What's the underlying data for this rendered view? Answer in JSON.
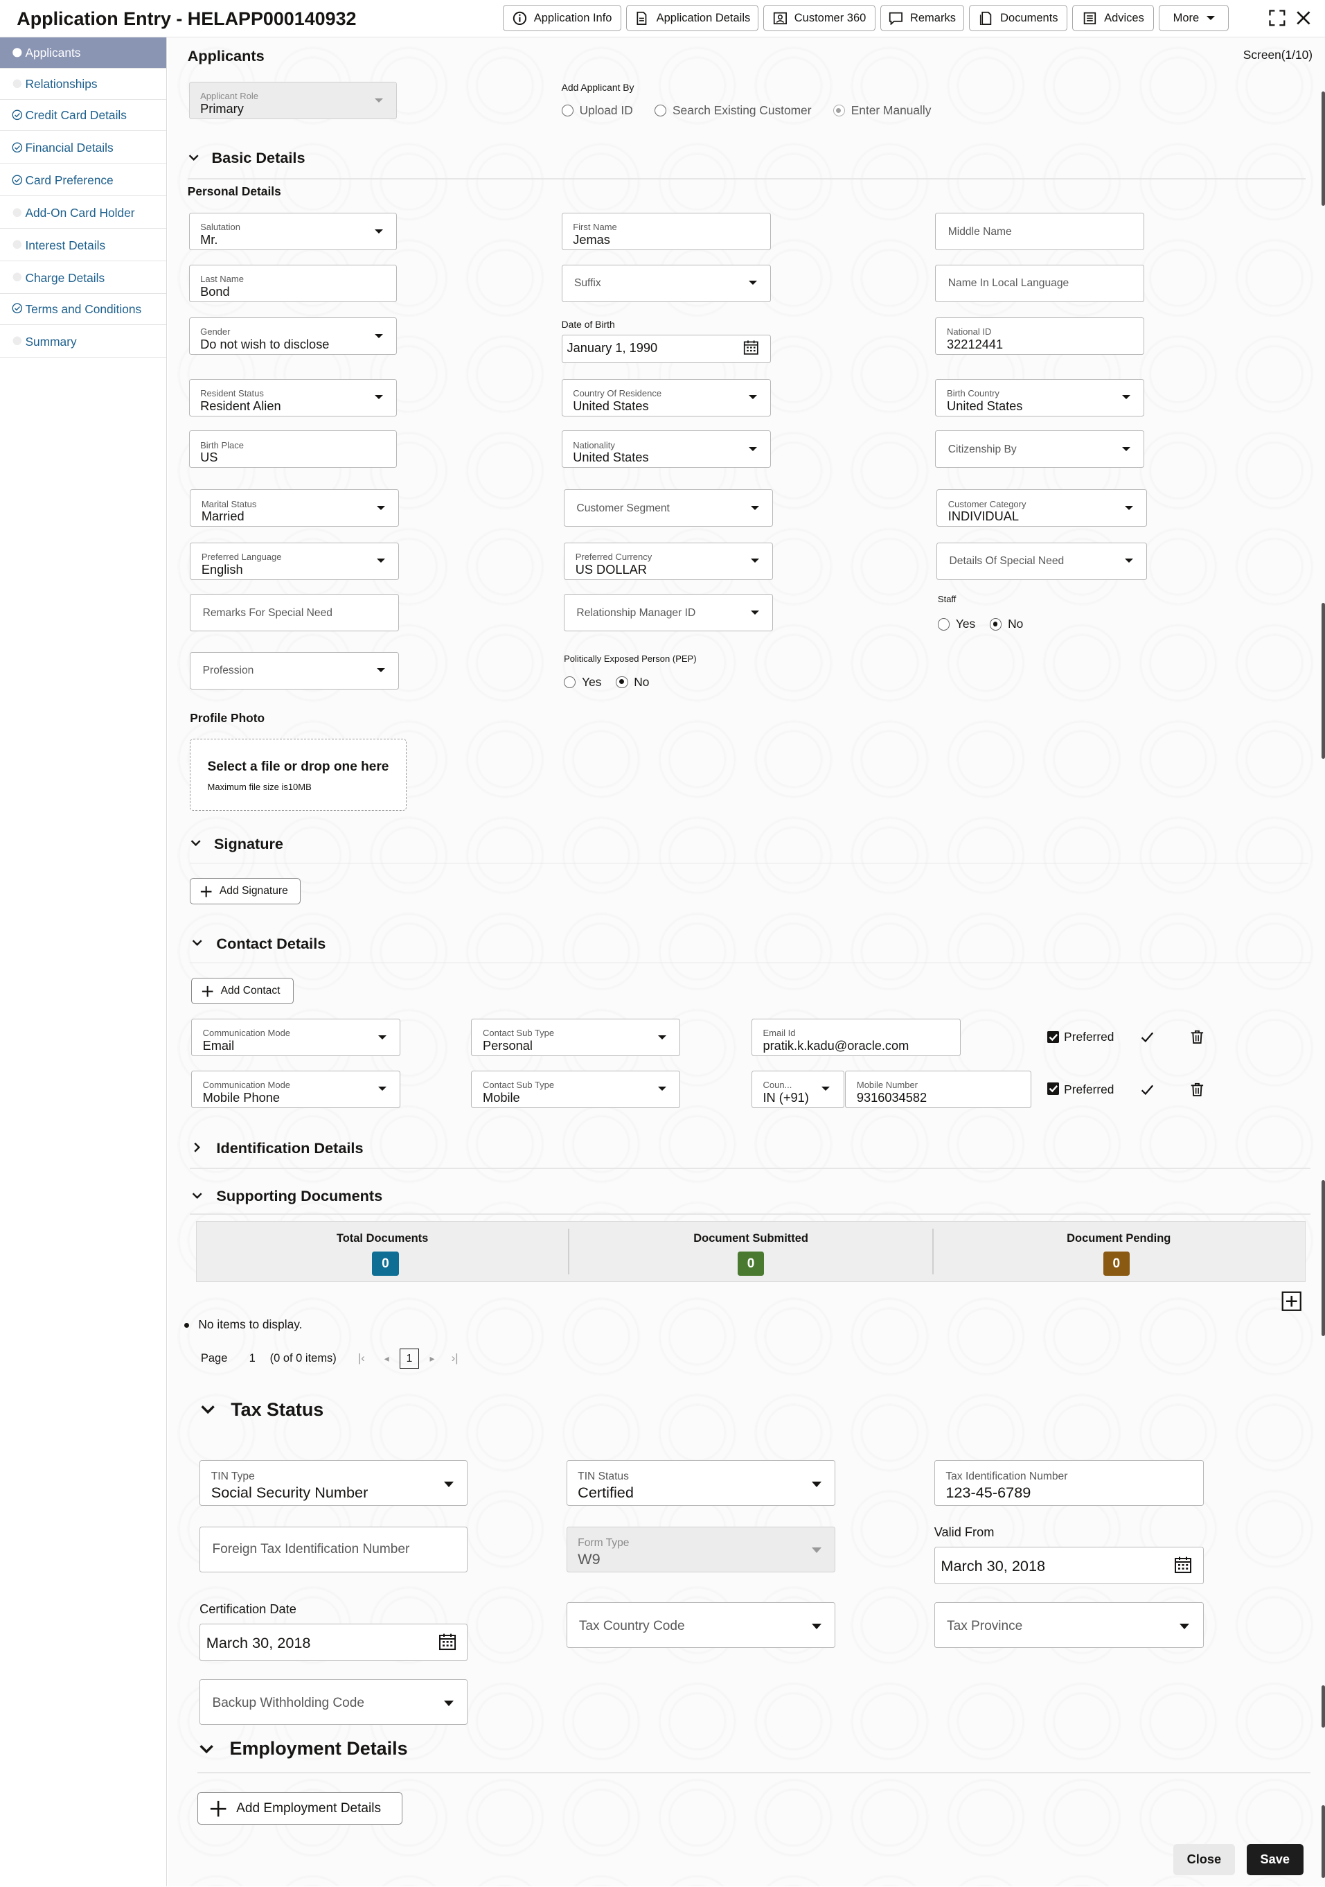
{
  "header": {
    "title": "Application Entry - HELAPP000140932",
    "buttons": [
      {
        "label": "Application Info",
        "icon": "info-icon"
      },
      {
        "label": "Application Details",
        "icon": "document-icon"
      },
      {
        "label": "Customer 360",
        "icon": "customer-card-icon"
      },
      {
        "label": "Remarks",
        "icon": "comment-icon"
      },
      {
        "label": "Documents",
        "icon": "documents-icon"
      },
      {
        "label": "Advices",
        "icon": "advices-icon"
      },
      {
        "label": "More",
        "icon": "chevron-down-icon"
      }
    ]
  },
  "sidebar": {
    "items": [
      {
        "label": "Applicants",
        "status": "current"
      },
      {
        "label": "Relationships",
        "status": "pending"
      },
      {
        "label": "Credit Card Details",
        "status": "done"
      },
      {
        "label": "Financial Details",
        "status": "done"
      },
      {
        "label": "Card Preference",
        "status": "done"
      },
      {
        "label": "Add-On Card Holder",
        "status": "pending"
      },
      {
        "label": "Interest Details",
        "status": "pending"
      },
      {
        "label": "Charge Details",
        "status": "pending"
      },
      {
        "label": "Terms and Conditions",
        "status": "done"
      },
      {
        "label": "Summary",
        "status": "pending"
      }
    ]
  },
  "page": {
    "title": "Applicants",
    "screen_indicator": "Screen(1/10)"
  },
  "applicant_role": {
    "label": "Applicant Role",
    "value": "Primary"
  },
  "add_applicant_by": {
    "label": "Add Applicant By",
    "options": [
      "Upload ID",
      "Search Existing Customer",
      "Enter Manually"
    ],
    "selected": "Enter Manually"
  },
  "basic_details": {
    "title": "Basic Details",
    "personal_title": "Personal Details",
    "salutation": {
      "label": "Salutation",
      "value": "Mr."
    },
    "first_name": {
      "label": "First Name",
      "value": "Jemas"
    },
    "middle_name": {
      "placeholder": "Middle Name"
    },
    "last_name": {
      "label": "Last Name",
      "value": "Bond"
    },
    "suffix": {
      "placeholder": "Suffix"
    },
    "local_name": {
      "placeholder": "Name In Local Language"
    },
    "gender": {
      "label": "Gender",
      "value": "Do not wish to disclose"
    },
    "dob": {
      "label": "Date of Birth",
      "value": "January 1, 1990"
    },
    "national_id": {
      "label": "National ID",
      "value": "32212441"
    },
    "resident_status": {
      "label": "Resident Status",
      "value": "Resident Alien"
    },
    "country_of_residence": {
      "label": "Country Of Residence",
      "value": "United States"
    },
    "birth_country": {
      "label": "Birth Country",
      "value": "United States"
    },
    "birth_place": {
      "label": "Birth Place",
      "value": "US"
    },
    "nationality": {
      "label": "Nationality",
      "value": "United States"
    },
    "citizenship_by": {
      "placeholder": "Citizenship By"
    },
    "marital_status": {
      "label": "Marital Status",
      "value": "Married"
    },
    "customer_segment": {
      "placeholder": "Customer Segment"
    },
    "customer_category": {
      "label": "Customer Category",
      "value": "INDIVIDUAL"
    },
    "preferred_language": {
      "label": "Preferred Language",
      "value": "English"
    },
    "preferred_currency": {
      "label": "Preferred Currency",
      "value": "US DOLLAR"
    },
    "special_need": {
      "placeholder": "Details Of Special Need"
    },
    "remarks_special_need": {
      "placeholder": "Remarks For Special Need"
    },
    "relationship_manager": {
      "placeholder": "Relationship Manager ID"
    },
    "staff": {
      "label": "Staff",
      "options": [
        "Yes",
        "No"
      ],
      "selected": "No"
    },
    "profession": {
      "placeholder": "Profession"
    },
    "pep": {
      "label": "Politically Exposed Person (PEP)",
      "options": [
        "Yes",
        "No"
      ],
      "selected": "No"
    },
    "profile_photo": {
      "title": "Profile Photo",
      "upload_text": "Select a file or drop one here",
      "upload_hint": "Maximum file size is10MB"
    }
  },
  "signature": {
    "title": "Signature",
    "add_label": "Add Signature"
  },
  "contact_details": {
    "title": "Contact Details",
    "add_label": "Add Contact",
    "rows": [
      {
        "mode_label": "Communication Mode",
        "mode": "Email",
        "sub_label": "Contact Sub Type",
        "sub": "Personal",
        "value_label": "Email Id",
        "value": "pratik.k.kadu@oracle.com",
        "preferred": "Preferred"
      },
      {
        "mode_label": "Communication Mode",
        "mode": "Mobile Phone",
        "sub_label": "Contact Sub Type",
        "sub": "Mobile",
        "code_label": "Coun...",
        "code": "IN (+91)",
        "value_label": "Mobile Number",
        "value": "9316034582",
        "preferred": "Preferred"
      }
    ]
  },
  "identification_details": {
    "title": "Identification Details"
  },
  "supporting_documents": {
    "title": "Supporting Documents",
    "total_label": "Total Documents",
    "total": "0",
    "submitted_label": "Document Submitted",
    "submitted": "0",
    "pending_label": "Document Pending",
    "pending": "0",
    "empty_text": "No items to display.",
    "pager": {
      "page_label": "Page",
      "page": "1",
      "items": "(0 of 0 items)",
      "current": "1"
    },
    "colors": {
      "total": "#0e6e94",
      "submitted": "#4a7a2f",
      "pending": "#8a5a12"
    }
  },
  "tax_status": {
    "title": "Tax Status",
    "tin_type": {
      "label": "TIN Type",
      "value": "Social Security Number"
    },
    "tin_status": {
      "label": "TIN Status",
      "value": "Certified"
    },
    "tin": {
      "label": "Tax Identification Number",
      "value": "123-45-6789"
    },
    "foreign_tin": {
      "placeholder": "Foreign Tax Identification Number"
    },
    "form_type": {
      "label": "Form Type",
      "value": "W9"
    },
    "valid_from": {
      "label": "Valid From",
      "value": "March 30, 2018"
    },
    "certification_date": {
      "label": "Certification Date",
      "value": "March 30, 2018"
    },
    "tax_country_code": {
      "placeholder": "Tax Country Code"
    },
    "tax_province": {
      "placeholder": "Tax Province"
    },
    "backup_withholding": {
      "placeholder": "Backup Withholding Code"
    }
  },
  "employment_details": {
    "title": "Employment Details",
    "add_label": "Add Employment Details"
  },
  "footer": {
    "close_label": "Close",
    "save_label": "Save"
  }
}
